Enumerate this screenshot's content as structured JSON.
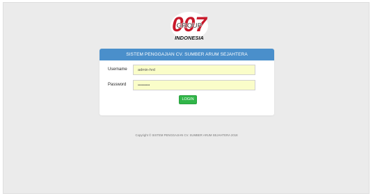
{
  "logo": {
    "main_text": "007",
    "sub_text": "GROUP",
    "country_text": "INDONESIA"
  },
  "panel": {
    "title": "SISTEM PENGGAJIAN CV. SUMBER ARUM SEJAHTERA"
  },
  "form": {
    "username_label": "Username",
    "username_value": "admin-hrd",
    "password_label": "Password",
    "password_value": "•••••••••",
    "login_label": "LOGIN"
  },
  "footer": {
    "copyright": "Copyright © SISTEM PENGGAJIAN CV. SUMBER ARUM SEJAHTERA 2018"
  },
  "colors": {
    "page_bg": "#ebebeb",
    "panel_header": "#4a8fcb",
    "input_bg": "#fafdc9",
    "login_button": "#31b649"
  }
}
